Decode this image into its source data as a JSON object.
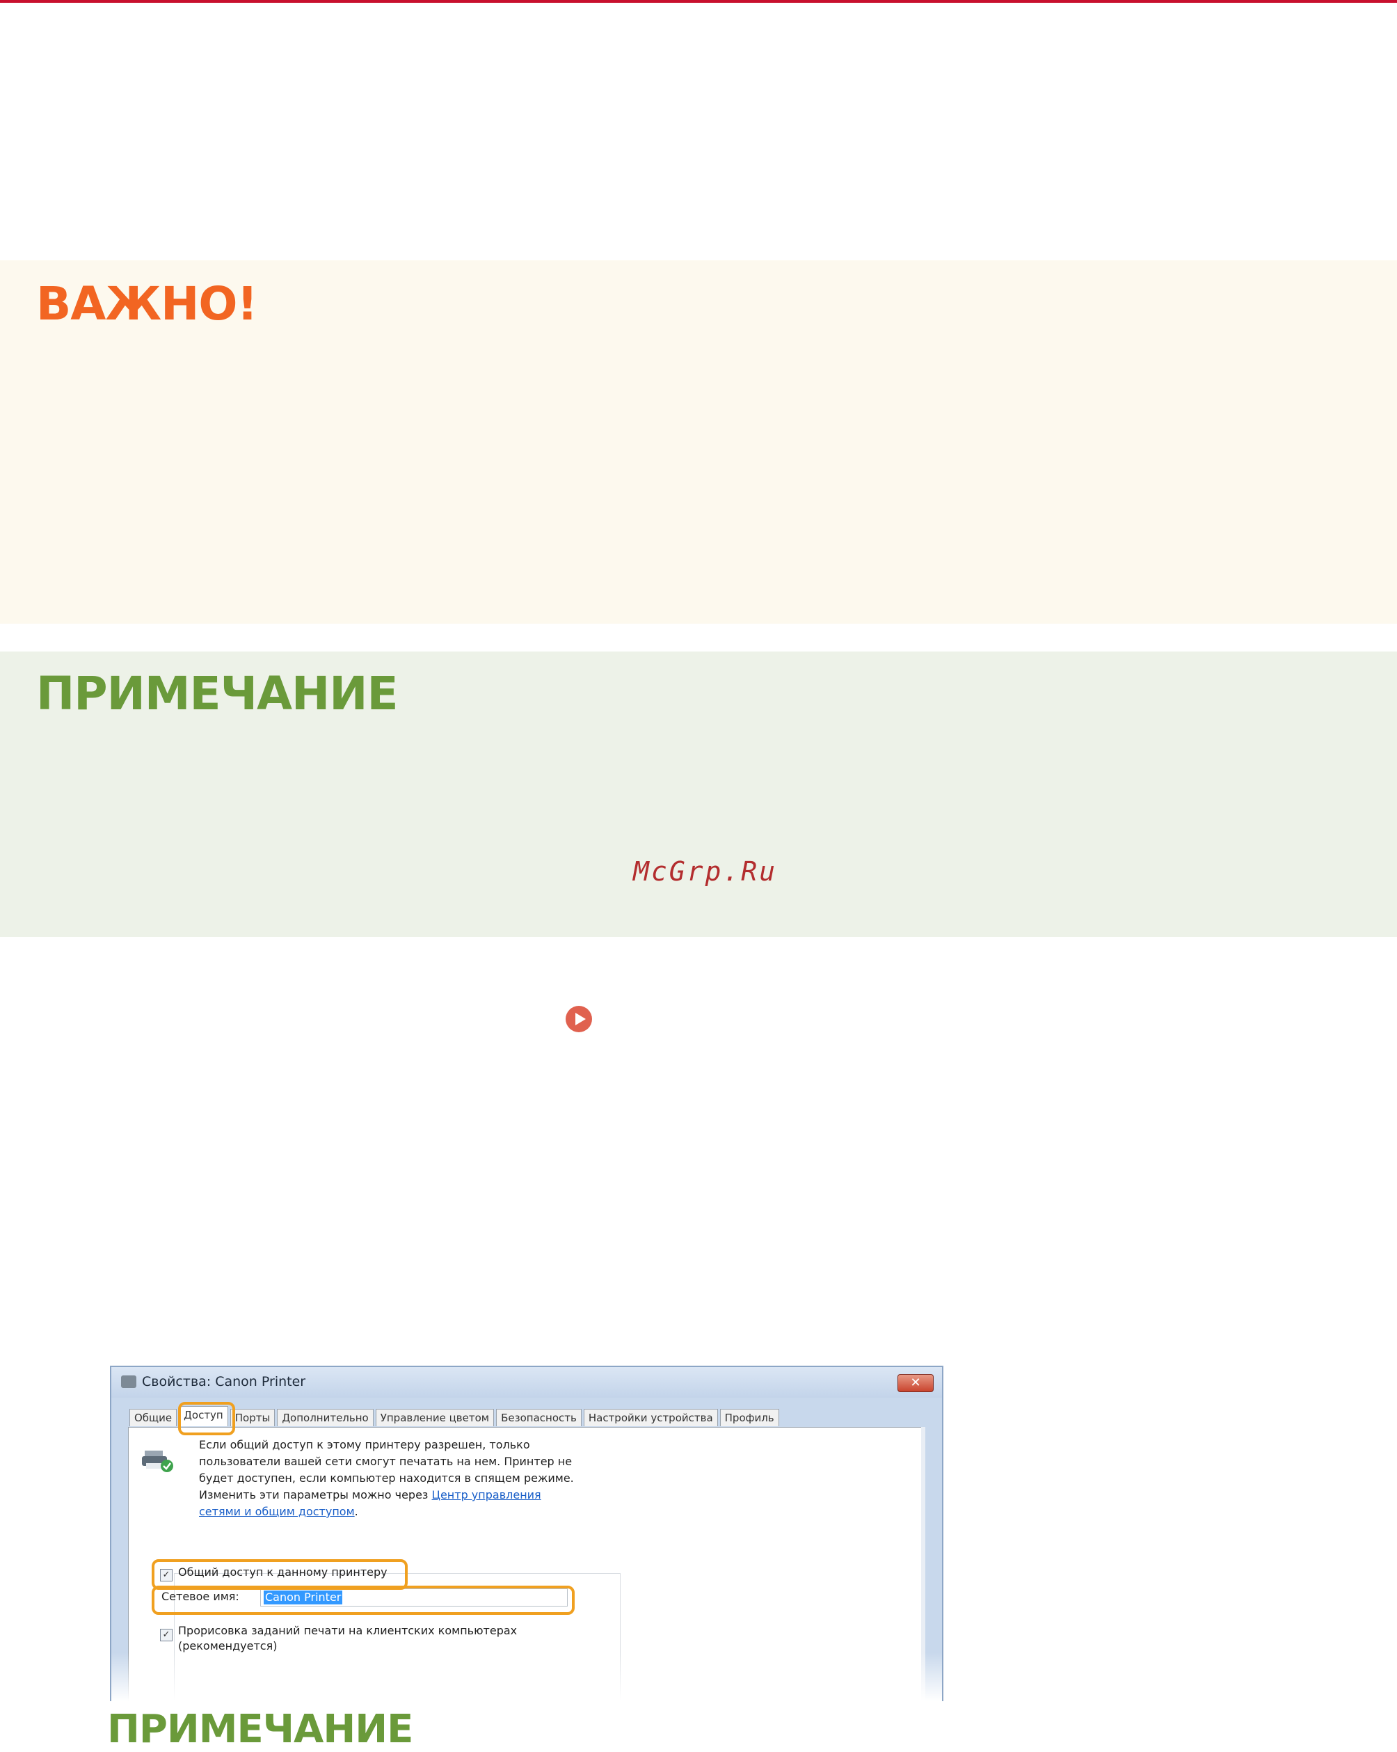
{
  "important": {
    "heading": "ВАЖНО!"
  },
  "note": {
    "heading": "ПРИМЕЧАНИЕ"
  },
  "watermark": "McGrp.Ru",
  "bottom_note": {
    "heading": "ПРИМЕЧАНИЕ"
  },
  "dialog": {
    "title": "Свойства: Canon Printer",
    "close_label": "✕",
    "tabs": [
      "Общие",
      "Доступ",
      "Порты",
      "Дополнительно",
      "Управление цветом",
      "Безопасность",
      "Настройки устройства",
      "Профиль"
    ],
    "description_lines": [
      "Если общий доступ к этому принтеру разрешен, только",
      "пользователи вашей сети смогут печатать на нем. Принтер не",
      "будет доступен, если компьютер находится в спящем режиме.",
      "Изменить эти параметры можно через"
    ],
    "link_part1": "Центр управления",
    "link_part2": "сетями и общим доступом",
    "link_suffix": ".",
    "share_label": "Общий доступ к данному принтеру",
    "share_name_label": "Сетевое имя:",
    "share_name_value": "Canon Printer",
    "render_label_line1": "Прорисовка заданий печати на клиентских компьютерах",
    "render_label_line2": "(рекомендуется)",
    "check_mark": "✓",
    "colors": {
      "highlight": "#f0a020",
      "link": "#1a5fc8",
      "selection": "#3399ff"
    }
  },
  "colors": {
    "important_heading": "#f26522",
    "note_heading": "#6a9a3a",
    "top_rule": "#c8102e",
    "watermark": "#b32d2e",
    "play_icon": "#e0614f"
  }
}
